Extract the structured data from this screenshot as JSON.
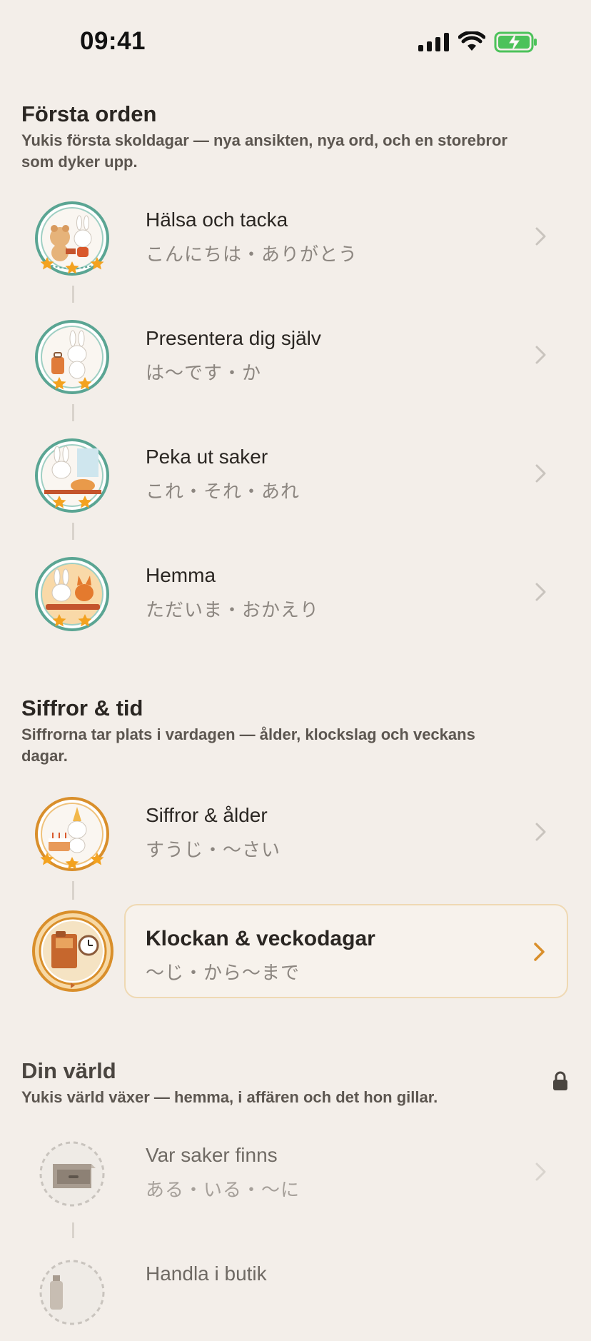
{
  "status_bar": {
    "time": "09:41"
  },
  "sections": [
    {
      "title": "Första orden",
      "subtitle": "Yukis första skoldagar — nya ansikten, nya ord, och en storebror som dyker upp.",
      "lessons": [
        {
          "title": "Hälsa och tacka",
          "subtitle": "こんにちは・ありがとう",
          "stars": 3,
          "state": "completed"
        },
        {
          "title": "Presentera dig själv",
          "subtitle": "は〜です・か",
          "stars": 2,
          "state": "completed"
        },
        {
          "title": "Peka ut saker",
          "subtitle": "これ・それ・あれ",
          "stars": 2,
          "state": "completed"
        },
        {
          "title": "Hemma",
          "subtitle": "ただいま・おかえり",
          "stars": 2,
          "state": "completed"
        }
      ]
    },
    {
      "title": "Siffror & tid",
      "subtitle": "Siffrorna tar plats i vardagen — ålder, klockslag och veckans dagar.",
      "lessons": [
        {
          "title": "Siffror & ålder",
          "subtitle": "すうじ・〜さい",
          "stars": 3,
          "state": "completed"
        },
        {
          "title": "Klockan & veckodagar",
          "subtitle": "〜じ・から〜まで",
          "stars": 0,
          "state": "current"
        }
      ]
    },
    {
      "title": "Din värld",
      "subtitle": "Yukis värld växer — hemma, i affären och det hon gillar.",
      "locked": true,
      "lessons": [
        {
          "title": "Var saker finns",
          "subtitle": "ある・いる・〜に",
          "stars": 0,
          "state": "locked"
        },
        {
          "title": "Handla i butik",
          "subtitle": "",
          "stars": 0,
          "state": "locked"
        }
      ]
    }
  ],
  "colors": {
    "background": "#f3eee9",
    "completed_ring": "#5aa593",
    "current_ring": "#d98f2b",
    "star": "#f3a21f",
    "chevron": "#c9c4be",
    "chevron_current": "#d98f2b",
    "card_border": "#efd9b3"
  },
  "icons": {
    "chevron": "chevron-right-icon",
    "lock": "lock-icon",
    "signal": "cellular-signal-icon",
    "wifi": "wifi-icon",
    "battery": "battery-charging-icon"
  }
}
